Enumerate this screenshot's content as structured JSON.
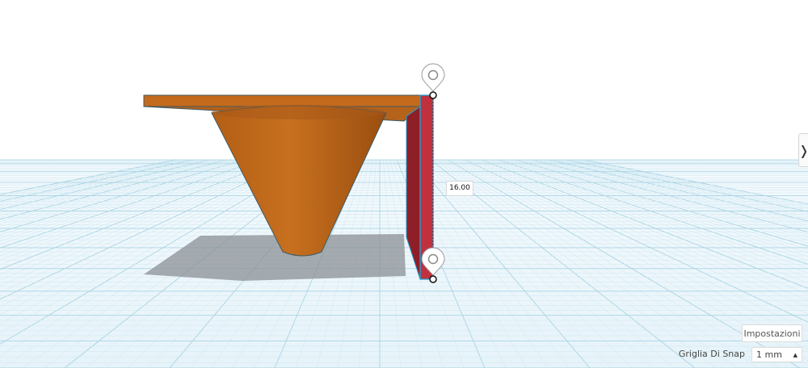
{
  "viewport": {
    "colors": {
      "sky": "#ffffff",
      "workplane": "#eaf6fb",
      "grid_minor": "#cfe8f2",
      "grid_major": "#a9d3e4",
      "shape_orange": "#c46a1c",
      "shape_orange_dark": "#9a4e0f",
      "shape_red": "#c0313d",
      "shape_red_dark": "#8e1e28",
      "shadow": "#8a8f95",
      "selection": "#1fa3d8"
    }
  },
  "dimension": {
    "value": "16.00"
  },
  "side_panel": {
    "toggle_icon": "❭"
  },
  "bottom": {
    "settings_label": "Impostazioni",
    "snap_label": "Griglia Di Snap",
    "snap_value": "1 mm",
    "snap_caret": "▲"
  }
}
